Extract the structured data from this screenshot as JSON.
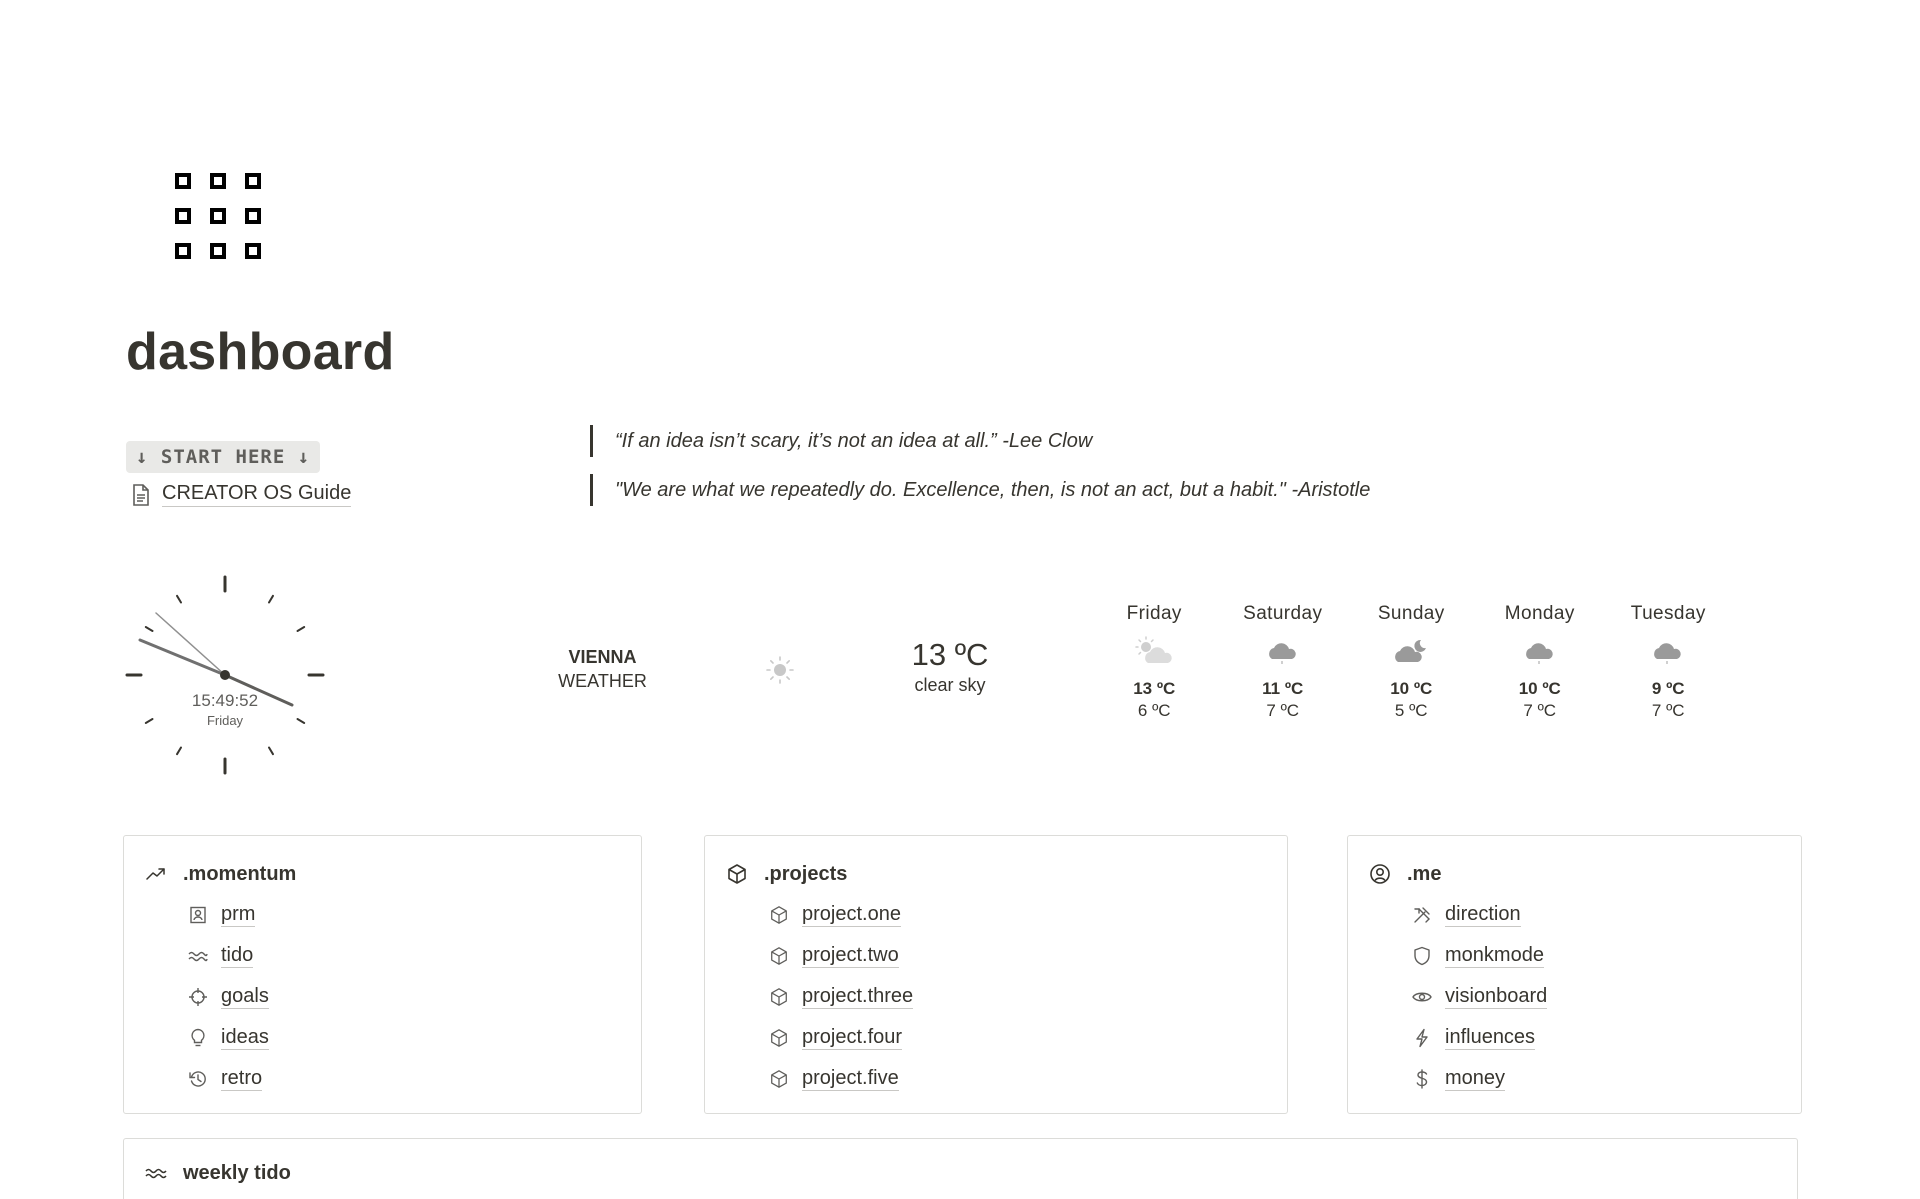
{
  "page": {
    "title": "dashboard",
    "icon": "grid-squares-icon"
  },
  "start": {
    "callout_label": "↓ START HERE ↓",
    "guide_label": "CREATOR OS Guide",
    "guide_icon": "page-icon"
  },
  "quotes": [
    {
      "text": "“If an idea isn’t scary, it’s not an idea at all.” -Lee Clow"
    },
    {
      "text": "\"We are what we repeatedly do. Excellence, then, is not an act, but a habit.\" -Aristotle"
    }
  ],
  "clock": {
    "time": "15:49:52",
    "day": "Friday"
  },
  "weather": {
    "city": "VIENNA",
    "label": "WEATHER",
    "current_icon": "sun-icon",
    "current_temp": "13 ºC",
    "current_desc": "clear sky",
    "forecast": [
      {
        "day": "Friday",
        "icon": "partly-cloudy-icon",
        "high": "13 ºC",
        "low": "6 ºC"
      },
      {
        "day": "Saturday",
        "icon": "cloud-drizzle-icon",
        "high": "11 ºC",
        "low": "7 ºC"
      },
      {
        "day": "Sunday",
        "icon": "cloud-moon-icon",
        "high": "10 ºC",
        "low": "5 ºC"
      },
      {
        "day": "Monday",
        "icon": "cloud-drizzle-icon",
        "high": "10 ºC",
        "low": "7 ºC"
      },
      {
        "day": "Tuesday",
        "icon": "cloud-drizzle-icon",
        "high": "9 ºC",
        "low": "7 ºC"
      }
    ]
  },
  "momentum": {
    "title": ".momentum",
    "icon": "trending-up-icon",
    "items": [
      {
        "label": "prm",
        "icon": "contact-book-icon"
      },
      {
        "label": "tido",
        "icon": "wave-lines-icon"
      },
      {
        "label": "goals",
        "icon": "crosshair-icon"
      },
      {
        "label": "ideas",
        "icon": "lightbulb-icon"
      },
      {
        "label": "retro",
        "icon": "history-icon"
      }
    ]
  },
  "projects": {
    "title": ".projects",
    "icon": "cube-icon",
    "items": [
      {
        "label": "project.one",
        "icon": "cube-icon"
      },
      {
        "label": "project.two",
        "icon": "cube-icon"
      },
      {
        "label": "project.three",
        "icon": "cube-icon"
      },
      {
        "label": "project.four",
        "icon": "cube-icon"
      },
      {
        "label": "project.five",
        "icon": "cube-icon"
      }
    ]
  },
  "me": {
    "title": ".me",
    "icon": "user-circle-icon",
    "items": [
      {
        "label": "direction",
        "icon": "tools-icon"
      },
      {
        "label": "monkmode",
        "icon": "shield-icon"
      },
      {
        "label": "visionboard",
        "icon": "eye-icon"
      },
      {
        "label": "influences",
        "icon": "lightning-icon"
      },
      {
        "label": "money",
        "icon": "dollar-icon"
      }
    ]
  },
  "weekly": {
    "title": "weekly tido",
    "icon": "wave-lines-icon"
  }
}
